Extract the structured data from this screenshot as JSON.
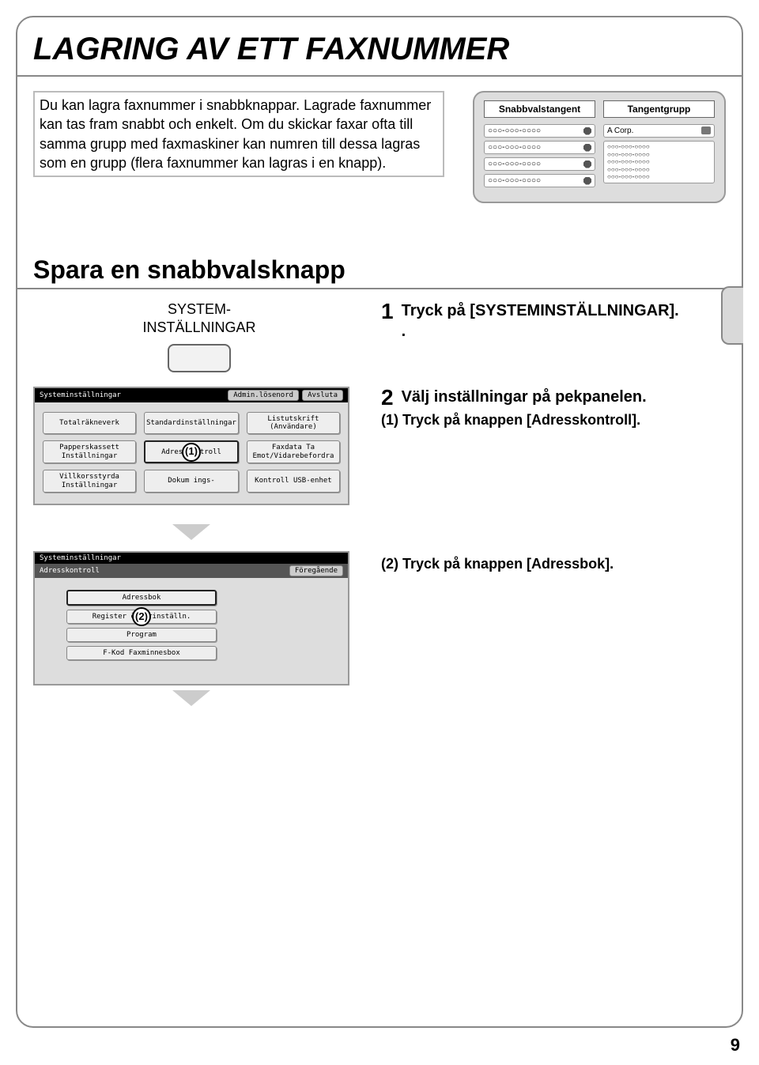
{
  "page_title": "LAGRING AV ETT FAXNUMMER",
  "intro": "Du kan lagra faxnummer i snabbknappar. Lagrade faxnummer kan tas fram snabbt och enkelt.\nOm du skickar faxar ofta till samma grupp med faxmaskiner kan numren till dessa lagras som en grupp (flera faxnummer kan lagras i en knapp).",
  "diagram": {
    "col_left_header": "Snabbvalstangent",
    "col_right_header": "Tangentgrupp",
    "speed_dial_number": "○○○-○○○-○○○○",
    "group_name": "A Corp.",
    "group_member": "○○○-○○○-○○○○"
  },
  "sub_title": "Spara en snabbvalsknapp",
  "step1": {
    "key_label": "SYSTEM-\nINSTÄLLNINGAR",
    "num": "1",
    "text": "Tryck på [SYSTEMINSTÄLLNINGAR].",
    "dot": "."
  },
  "step2": {
    "num": "2",
    "text": "Välj inställningar på pekpanelen.",
    "substep": "(1) Tryck på knappen [Adresskontroll].",
    "callout": "(1)"
  },
  "step3": {
    "substep": "(2) Tryck på knappen [Adressbok].",
    "callout": "(2)"
  },
  "screen1": {
    "title": "Systeminställningar",
    "btn_admin": "Admin.lösenord",
    "btn_exit": "Avsluta",
    "buttons": [
      "Totalräkneverk",
      "Standardinställningar",
      "Listutskrift (Användare)",
      "Papperskassett Inställningar",
      "Adresskontroll",
      "Faxdata Ta Emot/Vidarebefordra",
      "Villkorsstyrda Inställningar",
      "Dokum          ings-",
      "Kontroll USB-enhet"
    ]
  },
  "screen2": {
    "title": "Systeminställningar",
    "subtitle": "Adresskontroll",
    "btn_back": "Föregående",
    "buttons": [
      "Adressbok",
      "Register öv       arinställn.",
      "Program",
      "F-Kod Faxminnesbox"
    ]
  },
  "page_number": "9"
}
